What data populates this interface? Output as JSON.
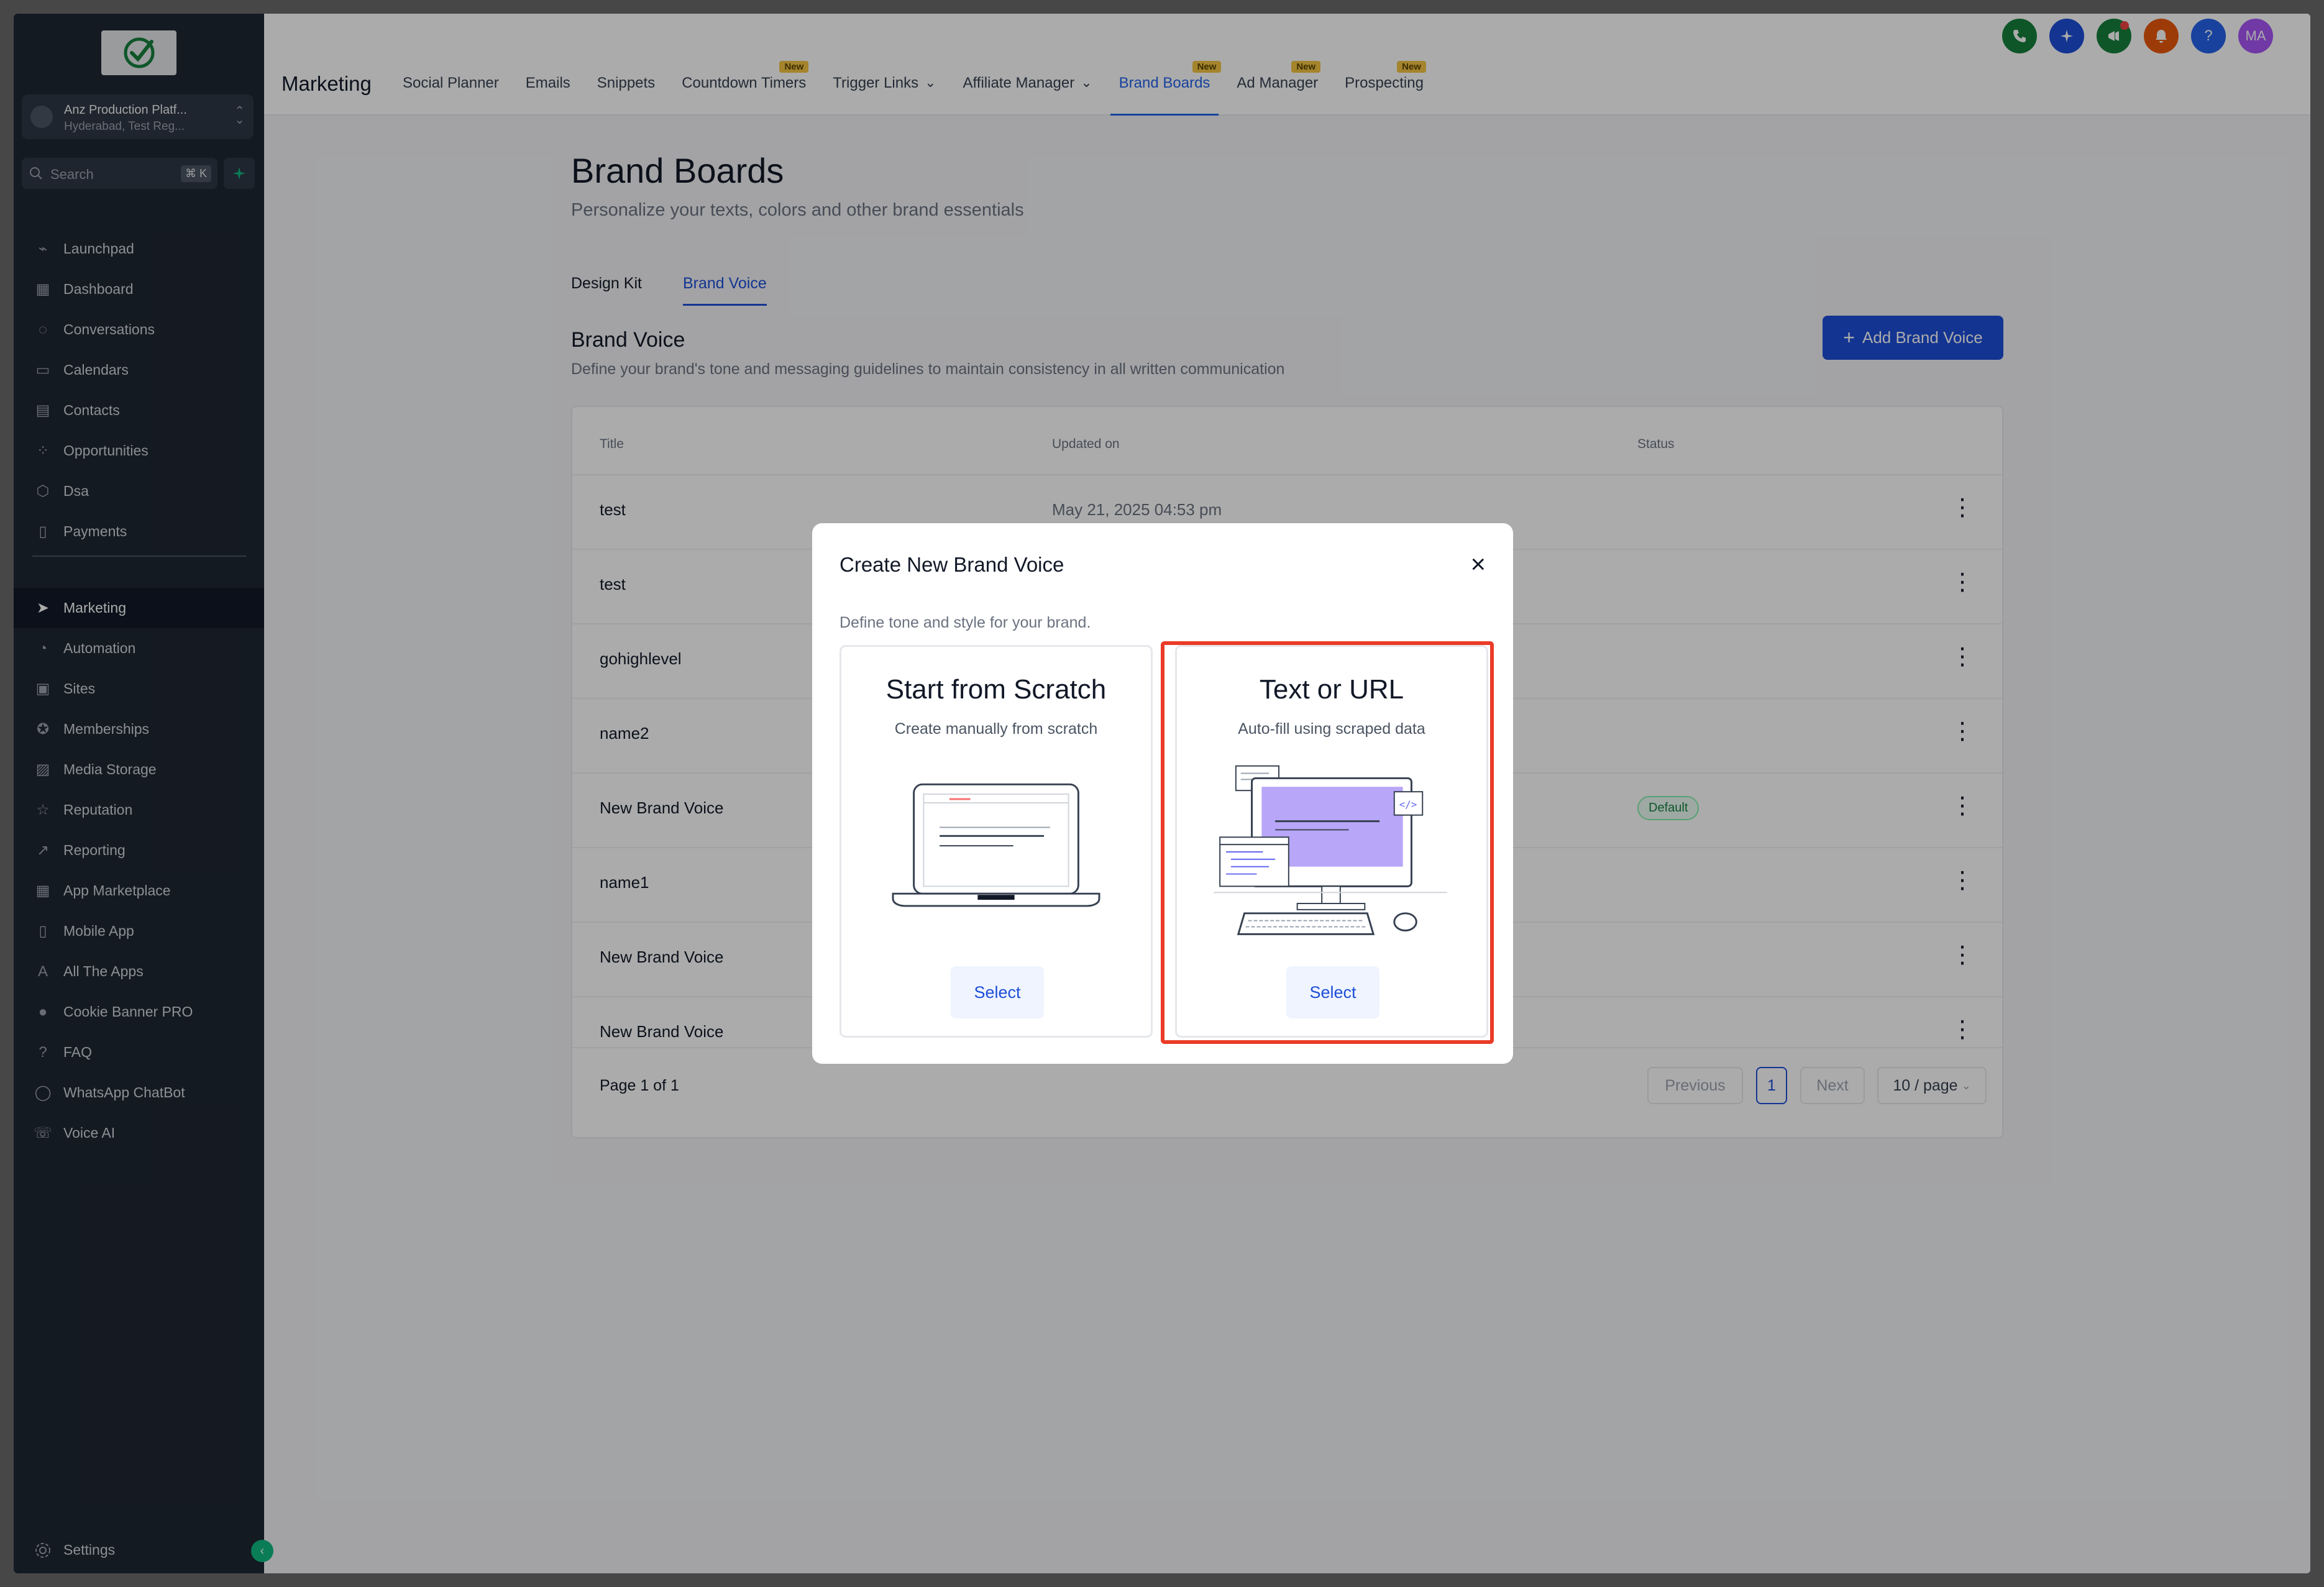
{
  "sidebar": {
    "account": {
      "name": "Anz Production Platf...",
      "location": "Hyderabad, Test Reg..."
    },
    "search": {
      "placeholder": "Search",
      "shortcut": "⌘ K"
    },
    "items_top": [
      {
        "label": "Launchpad",
        "icon": "rocket-icon"
      },
      {
        "label": "Dashboard",
        "icon": "grid-icon"
      },
      {
        "label": "Conversations",
        "icon": "chat-icon"
      },
      {
        "label": "Calendars",
        "icon": "calendar-icon"
      },
      {
        "label": "Contacts",
        "icon": "contacts-icon"
      },
      {
        "label": "Opportunities",
        "icon": "network-icon"
      },
      {
        "label": "Dsa",
        "icon": "cube-icon"
      },
      {
        "label": "Payments",
        "icon": "receipt-icon"
      }
    ],
    "items_bottom": [
      {
        "label": "Marketing",
        "icon": "send-icon"
      },
      {
        "label": "Automation",
        "icon": "automation-icon"
      },
      {
        "label": "Sites",
        "icon": "sites-icon"
      },
      {
        "label": "Memberships",
        "icon": "award-icon"
      },
      {
        "label": "Media Storage",
        "icon": "image-icon"
      },
      {
        "label": "Reputation",
        "icon": "star-icon"
      },
      {
        "label": "Reporting",
        "icon": "trend-icon"
      },
      {
        "label": "App Marketplace",
        "icon": "apps-icon"
      },
      {
        "label": "Mobile App",
        "icon": "mobile-icon"
      },
      {
        "label": "All The Apps",
        "icon": "a-icon"
      },
      {
        "label": "Cookie Banner PRO",
        "icon": "cookie-icon"
      },
      {
        "label": "FAQ",
        "icon": "question-icon"
      },
      {
        "label": "WhatsApp ChatBot",
        "icon": "whatsapp-icon"
      },
      {
        "label": "Voice AI",
        "icon": "phone-icon"
      }
    ],
    "settings_label": "Settings"
  },
  "header": {
    "section_title": "Marketing",
    "tabs": [
      {
        "label": "Social Planner",
        "new": false,
        "dropdown": false
      },
      {
        "label": "Emails",
        "new": false,
        "dropdown": false
      },
      {
        "label": "Snippets",
        "new": false,
        "dropdown": false
      },
      {
        "label": "Countdown Timers",
        "new": true,
        "dropdown": false
      },
      {
        "label": "Trigger Links",
        "new": false,
        "dropdown": true
      },
      {
        "label": "Affiliate Manager",
        "new": false,
        "dropdown": true
      },
      {
        "label": "Brand Boards",
        "new": true,
        "dropdown": false,
        "active": true
      },
      {
        "label": "Ad Manager",
        "new": true,
        "dropdown": false
      },
      {
        "label": "Prospecting",
        "new": true,
        "dropdown": false
      }
    ],
    "new_badge": "New",
    "avatar_initials": "MA",
    "help_glyph": "?"
  },
  "page": {
    "title": "Brand Boards",
    "subtitle": "Personalize your texts, colors and other brand essentials",
    "subtabs": [
      "Design Kit",
      "Brand Voice"
    ],
    "section_title": "Brand Voice",
    "section_subtitle": "Define your brand's tone and messaging guidelines to maintain consistency in all written communication",
    "add_button": "Add Brand Voice"
  },
  "table": {
    "headers": {
      "title": "Title",
      "updated": "Updated on",
      "status": "Status"
    },
    "rows": [
      {
        "title": "test",
        "updated": "May 21, 2025 04:53 pm",
        "status": ""
      },
      {
        "title": "test",
        "updated": "",
        "status": ""
      },
      {
        "title": "gohighlevel",
        "updated": "",
        "status": ""
      },
      {
        "title": "name2",
        "updated": "",
        "status": ""
      },
      {
        "title": "New Brand Voice",
        "updated": "",
        "status": "Default"
      },
      {
        "title": "name1",
        "updated": "",
        "status": ""
      },
      {
        "title": "New Brand Voice",
        "updated": "",
        "status": ""
      },
      {
        "title": "New Brand Voice",
        "updated": "",
        "status": ""
      }
    ],
    "pagination": {
      "info": "Page 1 of 1",
      "previous": "Previous",
      "page": "1",
      "next": "Next",
      "per_page": "10 / page"
    }
  },
  "modal": {
    "title": "Create New Brand Voice",
    "subtitle": "Define tone and style for your brand.",
    "options": [
      {
        "title": "Start from Scratch",
        "subtitle": "Create manually from scratch",
        "button": "Select"
      },
      {
        "title": "Text or URL",
        "subtitle": "Auto-fill using scraped data",
        "button": "Select"
      }
    ]
  },
  "colors": {
    "accent": "#1d4ed8",
    "sidebar_bg": "#1f2733",
    "highlight": "#ea3b27",
    "illustration_purple": "#b8a6f8"
  }
}
